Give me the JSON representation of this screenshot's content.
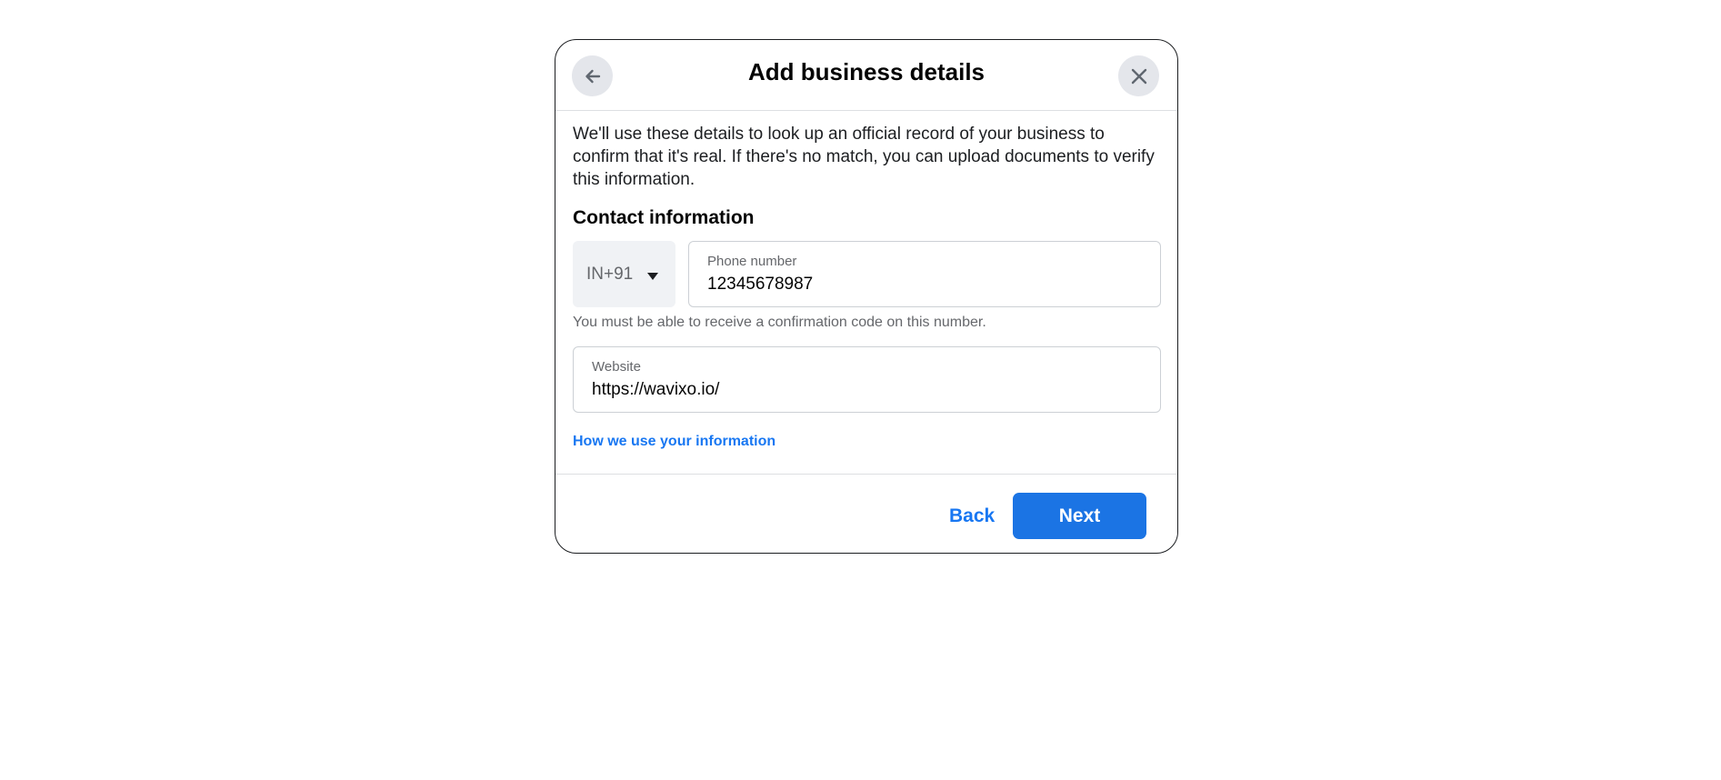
{
  "dialog": {
    "title": "Add business details",
    "back_icon": "arrow-left-icon",
    "close_icon": "close-icon",
    "description": "We'll use these details to look up an official record of your business to confirm that it's real. If there's no match, you can upload documents to verify this information."
  },
  "contact": {
    "section_title": "Contact information",
    "country_code": "IN+91",
    "caret_icon": "caret-down-icon",
    "phone_label": "Phone number",
    "phone_value": "12345678987",
    "helper_text": "You must be able to receive a confirmation code on this number.",
    "website_label": "Website",
    "website_value": "https://wavixo.io/"
  },
  "links": {
    "info_link": "How we use your information"
  },
  "footer": {
    "back_label": "Back",
    "next_label": "Next"
  },
  "colors": {
    "accent": "#1877f2",
    "button_bg": "#1b74e4",
    "icon_button_bg": "#e4e6eb",
    "select_bg": "#f0f2f5"
  }
}
